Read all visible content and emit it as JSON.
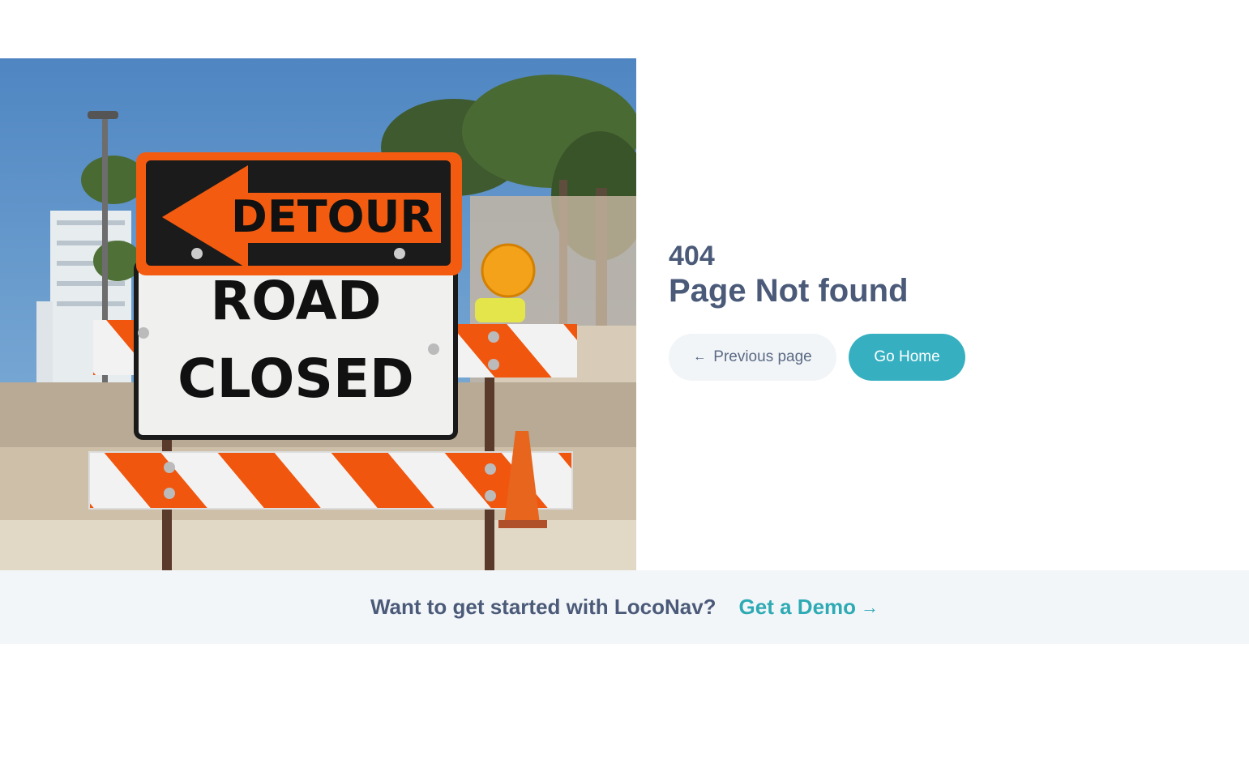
{
  "hero": {
    "sign_top": "DETOUR",
    "sign_main_line1": "ROAD",
    "sign_main_line2": "CLOSED"
  },
  "error": {
    "code": "404",
    "title": "Page Not found"
  },
  "buttons": {
    "previous_label": "Previous page",
    "previous_icon": "arrow-left-icon",
    "home_label": "Go Home"
  },
  "cta": {
    "text": "Want to get started with LocoNav?",
    "link_label": "Get a Demo",
    "link_icon": "arrow-right-icon"
  },
  "colors": {
    "heading": "#4a5a78",
    "accent": "#36b0c1",
    "link": "#2eaab4",
    "cta_bg": "#f3f6f9",
    "secondary_btn_bg": "#f2f5f8"
  }
}
